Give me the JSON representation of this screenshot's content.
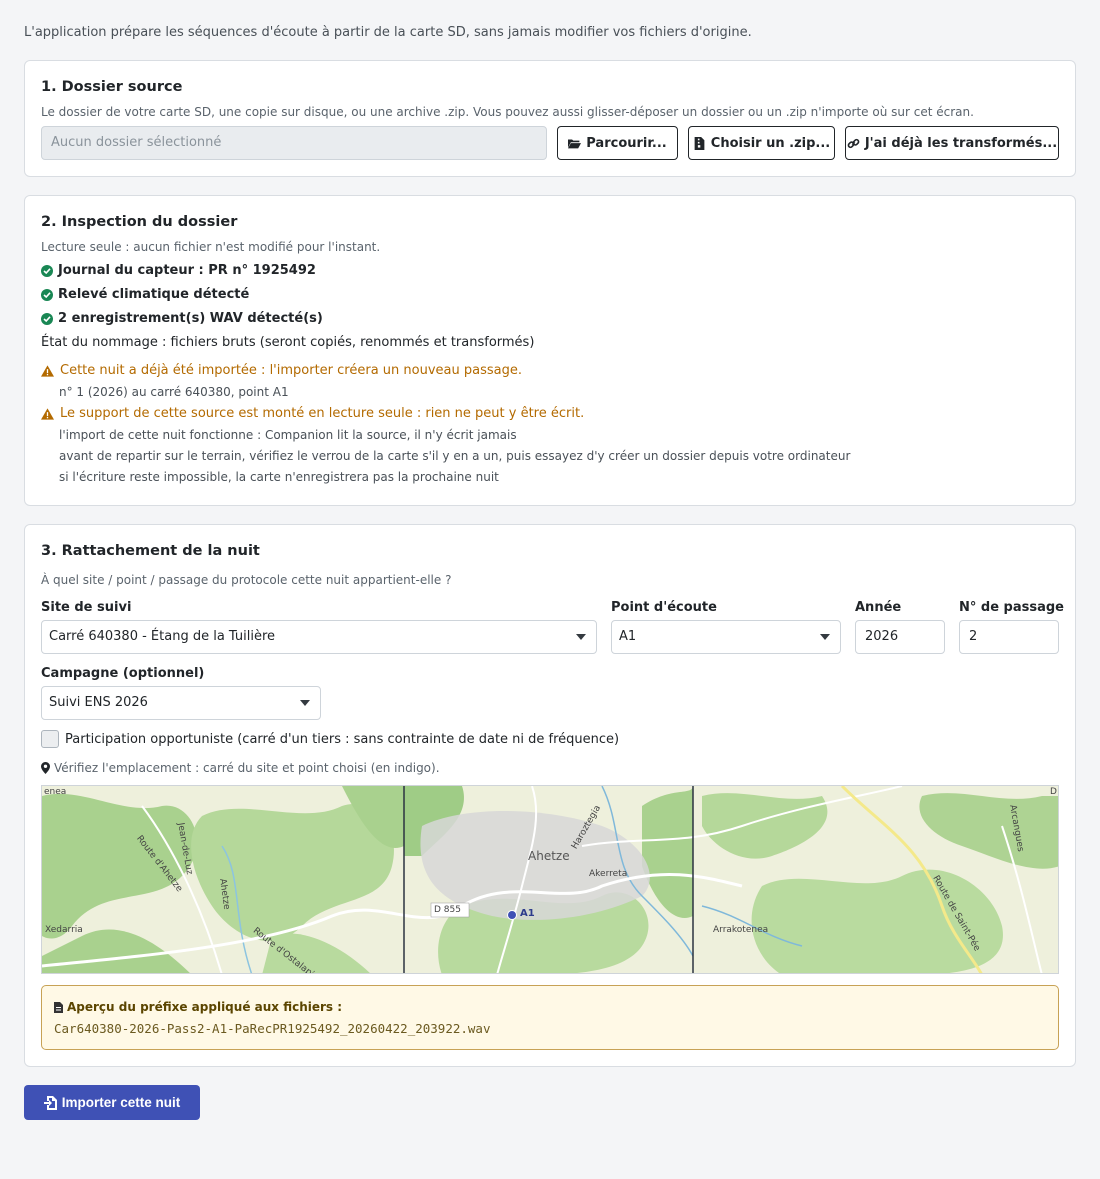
{
  "intro": "L'application prépare les séquences d'écoute à partir de la carte SD, sans jamais modifier vos fichiers d'origine.",
  "source": {
    "title": "1. Dossier source",
    "help": "Le dossier de votre carte SD, une copie sur disque, ou une archive .zip. Vous pouvez aussi glisser-déposer un dossier ou un .zip n'importe où sur cet écran.",
    "placeholder": "Aucun dossier sélectionné",
    "browse_label": "Parcourir...",
    "zip_label": "Choisir un .zip...",
    "already_label": "J'ai déjà les transformés..."
  },
  "inspection": {
    "title": "2. Inspection du dossier",
    "readonly_note": "Lecture seule : aucun fichier n'est modifié pour l'instant.",
    "checks": [
      "Journal du capteur : PR n° 1925492",
      "Relevé climatique détecté",
      "2 enregistrement(s) WAV détecté(s)"
    ],
    "naming_state": "État du nommage : fichiers bruts (seront copiés, renommés et transformés)",
    "warning1": "Cette nuit a déjà été importée : l'importer créera un nouveau passage.",
    "warning1_detail": "n° 1 (2026) au carré 640380, point A1",
    "warning2": "Le support de cette source est monté en lecture seule : rien ne peut y être écrit.",
    "warning2_details": [
      "l'import de cette nuit fonctionne : Companion lit la source, il n'y écrit jamais",
      "avant de repartir sur le terrain, vérifiez le verrou de la carte s'il y en a un, puis essayez d'y créer un dossier depuis votre ordinateur",
      "si l'écriture reste impossible, la carte n'enregistrera pas la prochaine nuit"
    ]
  },
  "attach": {
    "title": "3. Rattachement de la nuit",
    "question": "À quel site / point / passage du protocole cette nuit appartient-elle ?",
    "site_label": "Site de suivi",
    "site_value": "Carré 640380 - Étang de la Tuilière",
    "point_label": "Point d'écoute",
    "point_value": "A1",
    "year_label": "Année",
    "year_value": "2026",
    "pass_label": "N° de passage",
    "pass_value": "2",
    "campaign_label": "Campagne (optionnel)",
    "campaign_value": "Suivi ENS 2026",
    "opportunist_label": "Participation opportuniste (carré d'un tiers : sans contrainte de date ni de fréquence)",
    "location_note": "Vérifiez l'emplacement : carré du site et point choisi (en indigo).",
    "map": {
      "labels": [
        "enea",
        "Jean-de-Luz",
        "Route d'Ahetze",
        "Ahetze",
        "Xedarria",
        "Route d'Ostalapia",
        "Haroztegia",
        "Ahetze",
        "Akerreta",
        "D 855",
        "A1",
        "Arrakotenea",
        "Route de Saint-Pée",
        "Arcangues",
        "D"
      ],
      "point_color": "#3f51b5"
    },
    "preview_title": "Aperçu du préfixe appliqué aux fichiers :",
    "preview_code": "Car640380-2026-Pass2-A1-PaRecPR1925492_20260422_203922.wav"
  },
  "import_label": "Importer cette nuit"
}
